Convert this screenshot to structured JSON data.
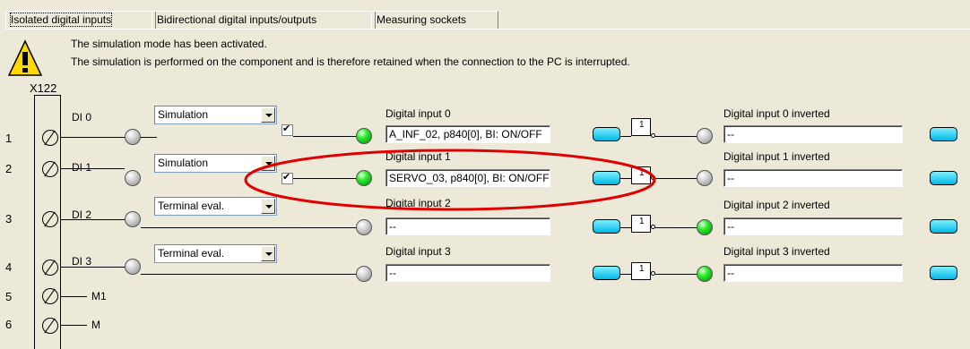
{
  "tabs": [
    {
      "label": "Isolated digital inputs",
      "active": true
    },
    {
      "label": "Bidirectional digital inputs/outputs",
      "active": false
    },
    {
      "label": "Measuring sockets",
      "active": false
    }
  ],
  "message": {
    "icon": "warning-icon",
    "line1": "The simulation mode has been activated.",
    "line2": "The simulation is performed on the component and is therefore retained when the connection to the PC is interrupted."
  },
  "connector": {
    "name": "X122",
    "m1_label": "M1",
    "m_label": "M"
  },
  "rows": [
    {
      "num": "1",
      "di": "DI 0",
      "mode": "Simulation",
      "sim_checked": true,
      "led": "green",
      "label": "Digital input 0",
      "value": "A_INF_02, p840[0], BI: ON/OFF",
      "inv_led": "grey",
      "inv_label": "Digital input 0 inverted",
      "inv_value": "--"
    },
    {
      "num": "2",
      "di": "DI 1",
      "mode": "Simulation",
      "sim_checked": true,
      "led": "green",
      "label": "Digital input 1",
      "value": "SERVO_03, p840[0], BI: ON/OFF",
      "inv_led": "grey",
      "inv_label": "Digital input 1 inverted",
      "inv_value": "--"
    },
    {
      "num": "3",
      "di": "DI 2",
      "mode": "Terminal eval.",
      "sim_checked": false,
      "led": "grey",
      "label": "Digital input 2",
      "value": "--",
      "inv_led": "green",
      "inv_label": "Digital input 2 inverted",
      "inv_value": "--"
    },
    {
      "num": "4",
      "di": "DI 3",
      "mode": "Terminal eval.",
      "sim_checked": false,
      "led": "grey",
      "label": "Digital input 3",
      "value": "--",
      "inv_led": "green",
      "inv_label": "Digital input 3 inverted",
      "inv_value": "--"
    }
  ],
  "extra_rows": [
    {
      "num": "5"
    },
    {
      "num": "6"
    }
  ],
  "not_gate_symbol": "1",
  "colors": {
    "background": "#ece9d8",
    "led_green": "#22dd22",
    "button_cyan": "#00ccff",
    "highlight_ellipse": "#e00000"
  }
}
